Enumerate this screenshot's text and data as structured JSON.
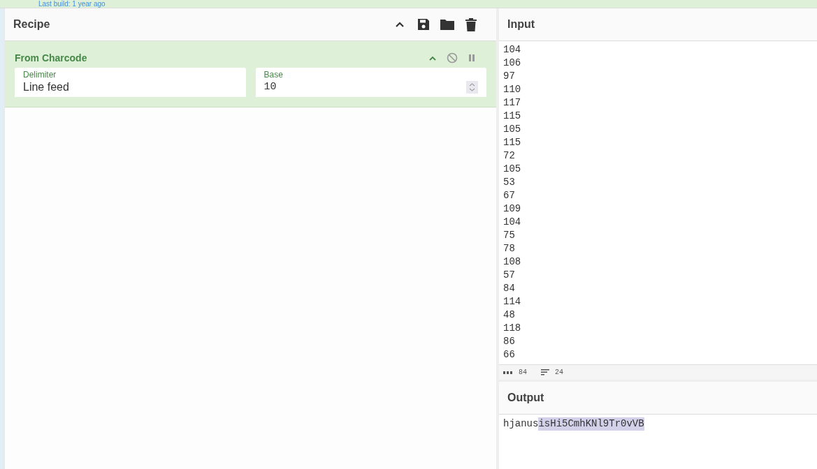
{
  "banner": {
    "text": "Last build: 1 year ago"
  },
  "recipe": {
    "title": "Recipe",
    "operations": [
      {
        "name": "From Charcode",
        "args": [
          {
            "kind": "text",
            "label": "Delimiter",
            "value": "Line feed"
          },
          {
            "kind": "number",
            "label": "Base",
            "value": "10"
          }
        ]
      }
    ]
  },
  "input": {
    "title": "Input",
    "lines": [
      "104",
      "106",
      "97",
      "110",
      "117",
      "115",
      "105",
      "115",
      "72",
      "105",
      "53",
      "67",
      "109",
      "104",
      "75",
      "78",
      "108",
      "57",
      "84",
      "114",
      "48",
      "118",
      "86",
      "66"
    ],
    "status": {
      "length": "84",
      "lines": "24"
    }
  },
  "output": {
    "title": "Output",
    "segments": [
      {
        "text": "hjanus",
        "highlighted": false
      },
      {
        "text": "isHi5CmhKNl9Tr0vVB",
        "highlighted": true
      }
    ]
  }
}
